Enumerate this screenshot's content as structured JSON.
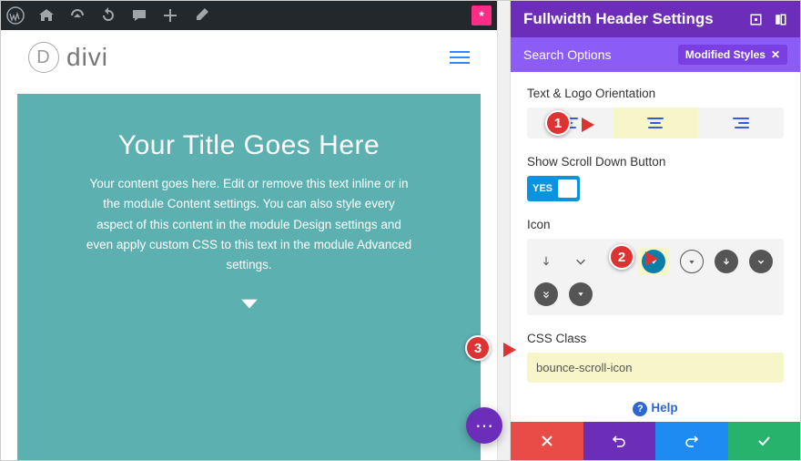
{
  "adminbar": {
    "asterisk": "*"
  },
  "divi": {
    "logo_text": "divi",
    "logo_letter": "D"
  },
  "hero": {
    "title": "Your Title Goes Here",
    "body": "Your content goes here. Edit or remove this text inline or in the module Content settings. You can also style every aspect of this content in the module Design settings and even apply custom CSS to this text in the module Advanced settings."
  },
  "panel": {
    "title": "Fullwidth Header Settings",
    "search_placeholder": "Search Options",
    "modified_badge": "Modified Styles",
    "labels": {
      "orientation": "Text & Logo Orientation",
      "show_scroll": "Show Scroll Down Button",
      "icon": "Icon",
      "css_class": "CSS Class"
    },
    "yes_label": "YES",
    "css_class_value": "bounce-scroll-icon",
    "help": "Help"
  },
  "callouts": {
    "one": "1",
    "two": "2",
    "three": "3"
  }
}
